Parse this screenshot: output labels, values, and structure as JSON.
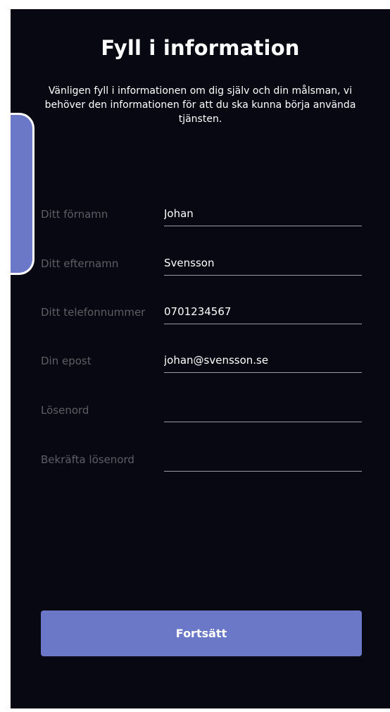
{
  "header": {
    "title": "Fyll i information",
    "subtitle": "Vänligen fyll i informationen om dig själv och din målsman, vi behöver den informationen för att du ska kunna börja använda tjänsten."
  },
  "form": {
    "fields": [
      {
        "label": "Ditt förnamn",
        "value": "Johan"
      },
      {
        "label": "Ditt efternamn",
        "value": "Svensson"
      },
      {
        "label": "Ditt telefonnummer",
        "value": "0701234567"
      },
      {
        "label": "Din epost",
        "value": "johan@svensson.se"
      },
      {
        "label": "Lösenord",
        "value": ""
      },
      {
        "label": "Bekräfta lösenord",
        "value": ""
      }
    ]
  },
  "actions": {
    "continue_label": "Fortsätt"
  },
  "colors": {
    "background": "#080812",
    "accent": "#6a78c7",
    "label": "#5e5e66",
    "text": "#ffffff"
  }
}
